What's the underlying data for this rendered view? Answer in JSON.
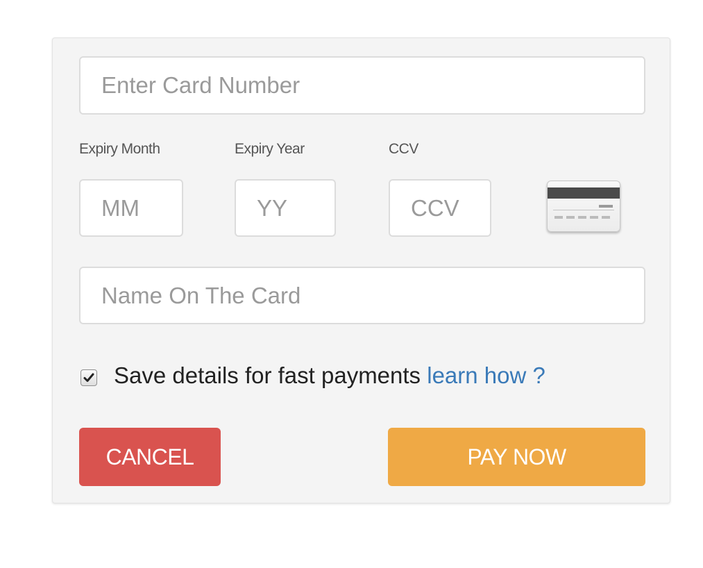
{
  "form": {
    "card_number": {
      "placeholder": "Enter Card Number",
      "value": ""
    },
    "expiry_month": {
      "label": "Expiry Month",
      "placeholder": "MM",
      "value": ""
    },
    "expiry_year": {
      "label": "Expiry Year",
      "placeholder": "YY",
      "value": ""
    },
    "ccv": {
      "label": "CCV",
      "placeholder": "CCV",
      "value": ""
    },
    "card_icon": "credit-card-back-icon",
    "name_on_card": {
      "placeholder": "Name On The Card",
      "value": ""
    },
    "save_details": {
      "checked": true,
      "label": "Save details for fast payments",
      "link_text": "learn how ?"
    }
  },
  "actions": {
    "cancel_label": "CANCEL",
    "pay_label": "PAY NOW"
  },
  "colors": {
    "cancel": "#d9534f",
    "pay": "#efa945",
    "link": "#3a7ab8",
    "panel": "#f4f4f4"
  }
}
